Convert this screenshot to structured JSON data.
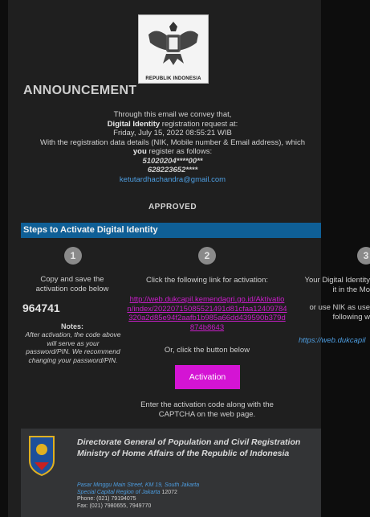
{
  "logo": {
    "caption": "REPUBLIK INDONESIA"
  },
  "announcement": {
    "title": "ANNOUNCEMENT",
    "line1": "Through this email we convey that,",
    "line2_bold": "Digital Identity",
    "line2_rest": " registration request at:",
    "line3": "Friday, July 15, 2022 08:55:21 WIB",
    "line4": "With the registration data details (NIK, Mobile number & Email address), which",
    "line5_bold": "you",
    "line5_rest": " register as follows:",
    "nik": "51020204****00**",
    "phone": "628223652****",
    "email": "ketutardhachandra@gmail.com",
    "status": "APPROVED"
  },
  "steps": {
    "header": "Steps to Activate Digital Identity",
    "step1": {
      "number": "1",
      "text": "Copy and save the activation code below",
      "code": "964741",
      "notes_title": "Notes:",
      "notes": "After activation, the code above will serve as your password/PIN. We recommend changing your password/PIN."
    },
    "step2": {
      "number": "2",
      "text": "Click the following link for activation:",
      "link": "http://web.dukcapil.kemendagri.go.id/Aktivation/index/20220715085521491d81cfaa12409784320a2d85e94f2aafb1b985a66dd439590b379d874b8643",
      "or_text": "Or, click the button below",
      "button_label": "Activation",
      "enter_text": "Enter the activation code along with the CAPTCHA on the web page."
    },
    "step3": {
      "number": "3",
      "line1": "Your Digital Identity",
      "line2": "it in the Mo",
      "line3": "or use NIK as use",
      "line4": "following w",
      "link": "https://web.dukcapil"
    }
  },
  "footer": {
    "title": "Directorate General of Population and Civil Registration Ministry of Home Affairs of the Republic of Indonesia",
    "address1": "Pasar Minggu Main Street, KM 19, South Jakarta",
    "address2": "Special Capital Region of Jakarta",
    "postal": "12072",
    "phone": "Phone: (021) 79194075",
    "fax": "Fax: (021) 7980655, 7949770"
  },
  "colors": {
    "steps_bar": "#0f5f96",
    "button": "#d414d4",
    "link_magenta": "#c81ec8",
    "link_blue": "#4d9de0"
  }
}
